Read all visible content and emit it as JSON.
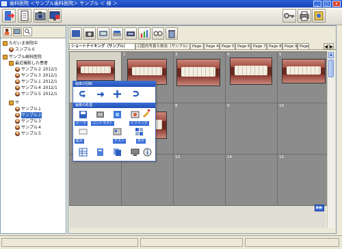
{
  "window": {
    "title": "歯科医院 ＜サンプル歯科医院＞ サンプル ＜ 様 ＞",
    "minimize": "_",
    "maximize": "□",
    "close": "x"
  },
  "tree": {
    "items": [
      {
        "label": "ただいま来院中",
        "indent": 0,
        "type": "root"
      },
      {
        "label": "スンプル６",
        "indent": 1,
        "type": "person"
      },
      {
        "label": "サンプル歯科医院",
        "indent": 0,
        "type": "root"
      },
      {
        "label": "最近撮影した患者",
        "indent": 1,
        "type": "root"
      },
      {
        "label": "サンプル２ 2012/1",
        "indent": 2,
        "type": "person"
      },
      {
        "label": "サンプル３ 2012/1",
        "indent": 2,
        "type": "person"
      },
      {
        "label": "サンプル１ 2012/1",
        "indent": 2,
        "type": "person"
      },
      {
        "label": "サンプル４ 2012/1",
        "indent": 2,
        "type": "person"
      },
      {
        "label": "サンプル５ 2012/1",
        "indent": 2,
        "type": "person"
      },
      {
        "label": "サ",
        "indent": 1,
        "type": "root"
      },
      {
        "label": "サンプル１",
        "indent": 2,
        "type": "person"
      },
      {
        "label": "サンプル２",
        "indent": 2,
        "type": "person",
        "selected": true
      },
      {
        "label": "サンプル３",
        "indent": 2,
        "type": "person"
      },
      {
        "label": "サンプル４",
        "indent": 2,
        "type": "person"
      },
      {
        "label": "サンプル５",
        "indent": 2,
        "type": "person"
      }
    ]
  },
  "page_tabs": {
    "tabs": [
      "ショートテイキング（サンプル）",
      "口腔内写真５枚法（サンプル）",
      "Page 3",
      "Page 4",
      "Page 5",
      "Page 6",
      "Page 7",
      "Page 8",
      "Page 9",
      "Page 10",
      "Page 8",
      "Page 9"
    ],
    "active_index": 0,
    "left_arrow": "◀",
    "right_arrow": "▶"
  },
  "grid": {
    "cells": [
      "",
      "2",
      "3",
      "4",
      "5",
      "",
      "7",
      "8",
      "9",
      "10",
      "",
      "12",
      "13",
      "14",
      "15"
    ]
  },
  "palette": {
    "title": "画像の回転",
    "section2": "画像の処理",
    "label_a": "ピーク",
    "label_b": "コントラスト",
    "label_c": "トリミング",
    "label_d": "拡大",
    "label_e": "テスト",
    "label_f": "あか"
  },
  "pager": {
    "next": "▶▶"
  }
}
